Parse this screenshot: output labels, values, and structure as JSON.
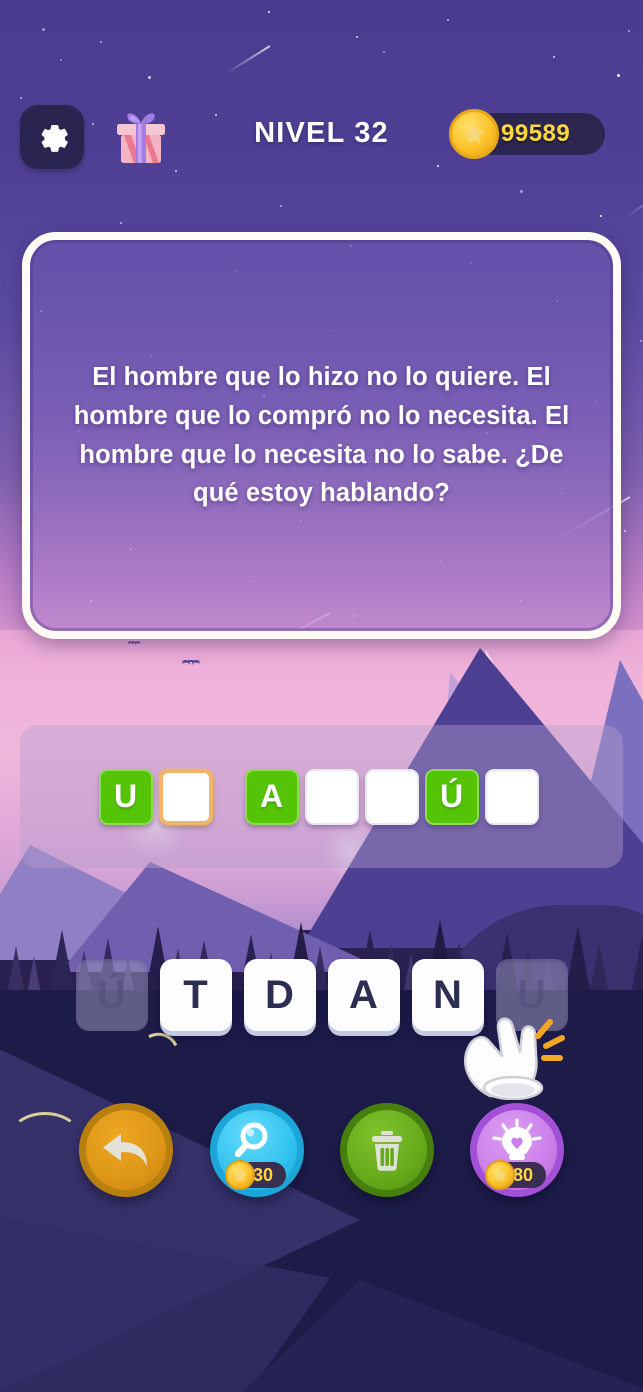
{
  "header": {
    "settings_icon": "gear-icon",
    "gift_icon": "gift-box-icon",
    "level_title": "NIVEL 32",
    "coin_amount": "99589",
    "coin_icon": "star-coin-icon"
  },
  "riddle": {
    "text": "El hombre que lo hizo no lo quiere. El hombre que lo compró no lo necesita. El hombre que lo necesita no lo sabe. ¿De qué estoy hablando?"
  },
  "answer_slots": [
    {
      "letter": "U",
      "state": "filled"
    },
    {
      "letter": "",
      "state": "active"
    },
    {
      "letter": "",
      "state": "gap"
    },
    {
      "letter": "A",
      "state": "filled"
    },
    {
      "letter": "",
      "state": "empty"
    },
    {
      "letter": "",
      "state": "empty"
    },
    {
      "letter": "Ú",
      "state": "filled"
    },
    {
      "letter": "",
      "state": "empty"
    }
  ],
  "keyboard": [
    {
      "letter": "Ú",
      "state": "used"
    },
    {
      "letter": "T",
      "state": "available"
    },
    {
      "letter": "D",
      "state": "available"
    },
    {
      "letter": "A",
      "state": "available"
    },
    {
      "letter": "N",
      "state": "available"
    },
    {
      "letter": "U",
      "state": "used"
    }
  ],
  "actions": [
    {
      "id": "back",
      "icon": "back-arrow-icon",
      "cost": null,
      "color": "#dd9616"
    },
    {
      "id": "search",
      "icon": "magnifier-icon",
      "cost": "30",
      "color": "#31c2f0"
    },
    {
      "id": "trash",
      "icon": "trash-can-icon",
      "cost": null,
      "color": "#66ab1b"
    },
    {
      "id": "hint",
      "icon": "lightbulb-icon",
      "cost": "80",
      "color": "#ca7fe9"
    }
  ],
  "cursor": {
    "icon": "pointing-hand-cursor",
    "target": "N"
  },
  "colors": {
    "sky_top": "#4b3c90",
    "sunset": "#efb6dc",
    "slot_filled": "#55c406",
    "slot_active_border": "#f0b56a",
    "coin_text": "#ffd83b",
    "ground": "#1d1b48"
  }
}
